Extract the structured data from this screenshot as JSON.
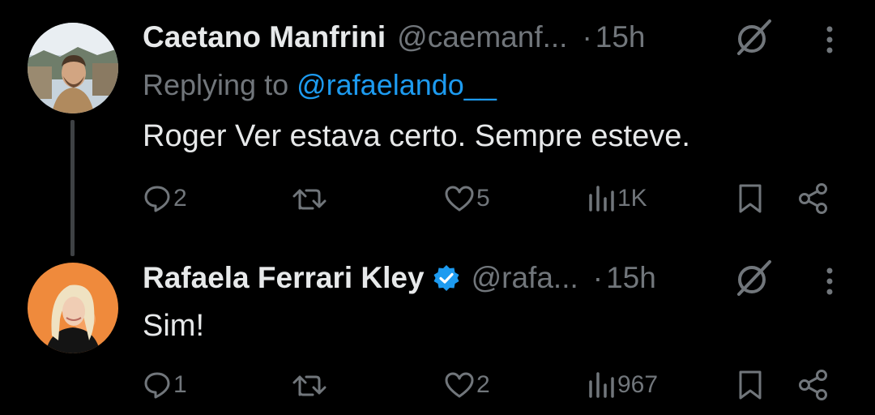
{
  "tweets": [
    {
      "name": "Caetano Manfrini",
      "handle": "@caemanf...",
      "dot": "·",
      "time": "15h",
      "replying_prefix": "Replying to",
      "replying_handle": "@rafaelando__",
      "text": "Roger Ver estava certo. Sempre esteve.",
      "verified": false,
      "stats": {
        "replies": "2",
        "reposts": "",
        "likes": "5",
        "views": "1K"
      }
    },
    {
      "name": "Rafaela Ferrari Kley",
      "handle": "@rafa...",
      "dot": "·",
      "time": "15h",
      "text": "Sim!",
      "verified": true,
      "stats": {
        "replies": "1",
        "reposts": "",
        "likes": "2",
        "views": "967"
      }
    }
  ],
  "colors": {
    "background": "#000000",
    "text": "#e7e9ea",
    "muted": "#71767b",
    "accent": "#1d9bf0",
    "thread_line": "#3e4144"
  },
  "icons": [
    "reply-icon",
    "repost-icon",
    "like-icon",
    "views-icon",
    "bookmark-icon",
    "share-icon",
    "grok-icon",
    "more-icon",
    "verified-badge-icon"
  ]
}
